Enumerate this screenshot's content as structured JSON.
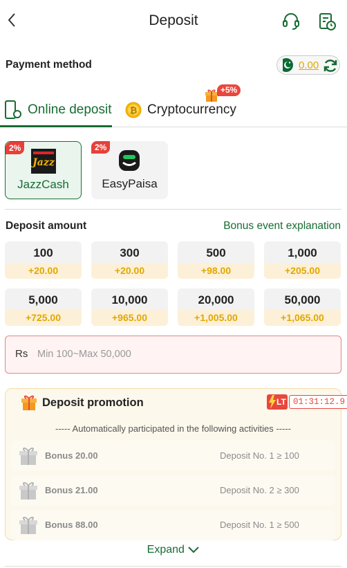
{
  "header": {
    "title": "Deposit",
    "icons": [
      "chevron-left-icon",
      "headset-icon",
      "history-icon"
    ]
  },
  "payment_method": {
    "label": "Payment method",
    "balance": "0.00",
    "flag": "pakistan-flag-icon"
  },
  "tabs": [
    {
      "label": "Online deposit",
      "icon": "phone-deposit-icon",
      "active": true
    },
    {
      "label": "Cryptocurrency",
      "icon": "bitcoin-icon",
      "badge": "+5%"
    }
  ],
  "methods": [
    {
      "name": "JazzCash",
      "badge": "2%",
      "selected": true
    },
    {
      "name": "EasyPaisa",
      "badge": "2%",
      "selected": false
    }
  ],
  "deposit_amount": {
    "label": "Deposit amount",
    "bonus_link": "Bonus event explanation",
    "amounts": [
      {
        "amount": "100",
        "bonus": "+20.00"
      },
      {
        "amount": "300",
        "bonus": "+20.00"
      },
      {
        "amount": "500",
        "bonus": "+98.00"
      },
      {
        "amount": "1,000",
        "bonus": "+205.00"
      },
      {
        "amount": "5,000",
        "bonus": "+725.00"
      },
      {
        "amount": "10,000",
        "bonus": "+965.00"
      },
      {
        "amount": "20,000",
        "bonus": "+1,005.00"
      },
      {
        "amount": "50,000",
        "bonus": "+1,065.00"
      }
    ],
    "currency": "Rs",
    "placeholder": "Min 100~Max 50,000"
  },
  "promotion": {
    "title": "Deposit promotion",
    "lt_label": "LT",
    "timer": "01:31:12.9",
    "auto_text": "----- Automatically participated in the following activities -----",
    "activities": [
      {
        "bonus": "Bonus 20.00",
        "condition": "Deposit No. 1 ≥ 100"
      },
      {
        "bonus": "Bonus 21.00",
        "condition": "Deposit No. 2 ≥ 300"
      },
      {
        "bonus": "Bonus 88.00",
        "condition": "Deposit No. 1 ≥ 500"
      }
    ],
    "expand_label": "Expand"
  },
  "colors": {
    "brand_green": "#176b33",
    "gold": "#e0a800",
    "badge_red": "#e5413a"
  }
}
